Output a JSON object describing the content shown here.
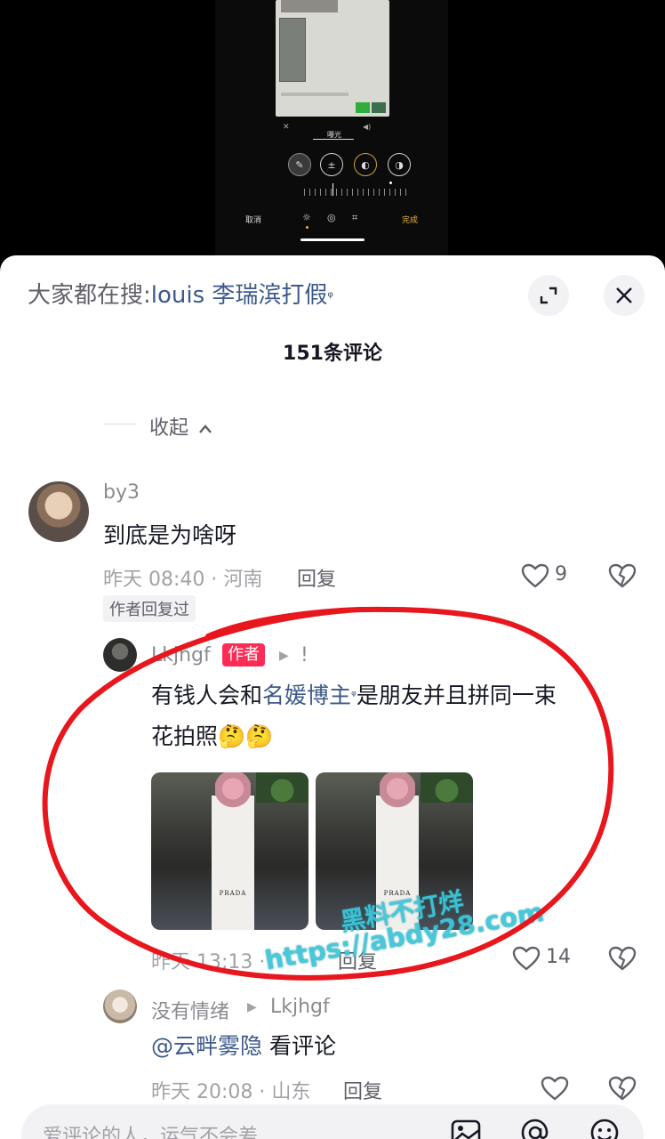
{
  "editor": {
    "mode_label": "曝光",
    "cancel_label": "取消",
    "done_label": "完成"
  },
  "search": {
    "prefix": "大家都在搜:",
    "term": "louis 李瑞滨打假"
  },
  "header": {
    "comment_count": "151条评论"
  },
  "collapse_label": "收起",
  "comments": [
    {
      "username": "by3",
      "text": "到底是为啥呀",
      "meta": "昨天 08:40 · 河南",
      "reply_label": "回复",
      "likes": "9",
      "tag": "作者回复过"
    }
  ],
  "author_reply": {
    "username": "Lkjhgf",
    "badge": "作者",
    "text_before": "有钱人会和",
    "text_link": "名媛博主",
    "text_after": "是朋友并且拼同一束",
    "text_line2": "花拍照🤔🤔",
    "image_brand": "PRADA",
    "meta": "昨天 13:13 · ",
    "reply_label": "回复",
    "likes": "14"
  },
  "reply2": {
    "username": "没有情绪",
    "reply_to": "Lkjhgf",
    "mention": "@云畔雾隐",
    "text": " 看评论",
    "meta": "昨天 20:08 · 山东",
    "reply_label": "回复"
  },
  "watermark": {
    "line1": "黑料不打烊",
    "line2": "https://abdy28.com"
  },
  "input": {
    "placeholder": "爱评论的人，运气不会差"
  },
  "colors": {
    "link": "#3d5a8a",
    "author_badge": "#fe2c55",
    "annotation": "#e8161d",
    "watermark": "#3fc6d8"
  }
}
